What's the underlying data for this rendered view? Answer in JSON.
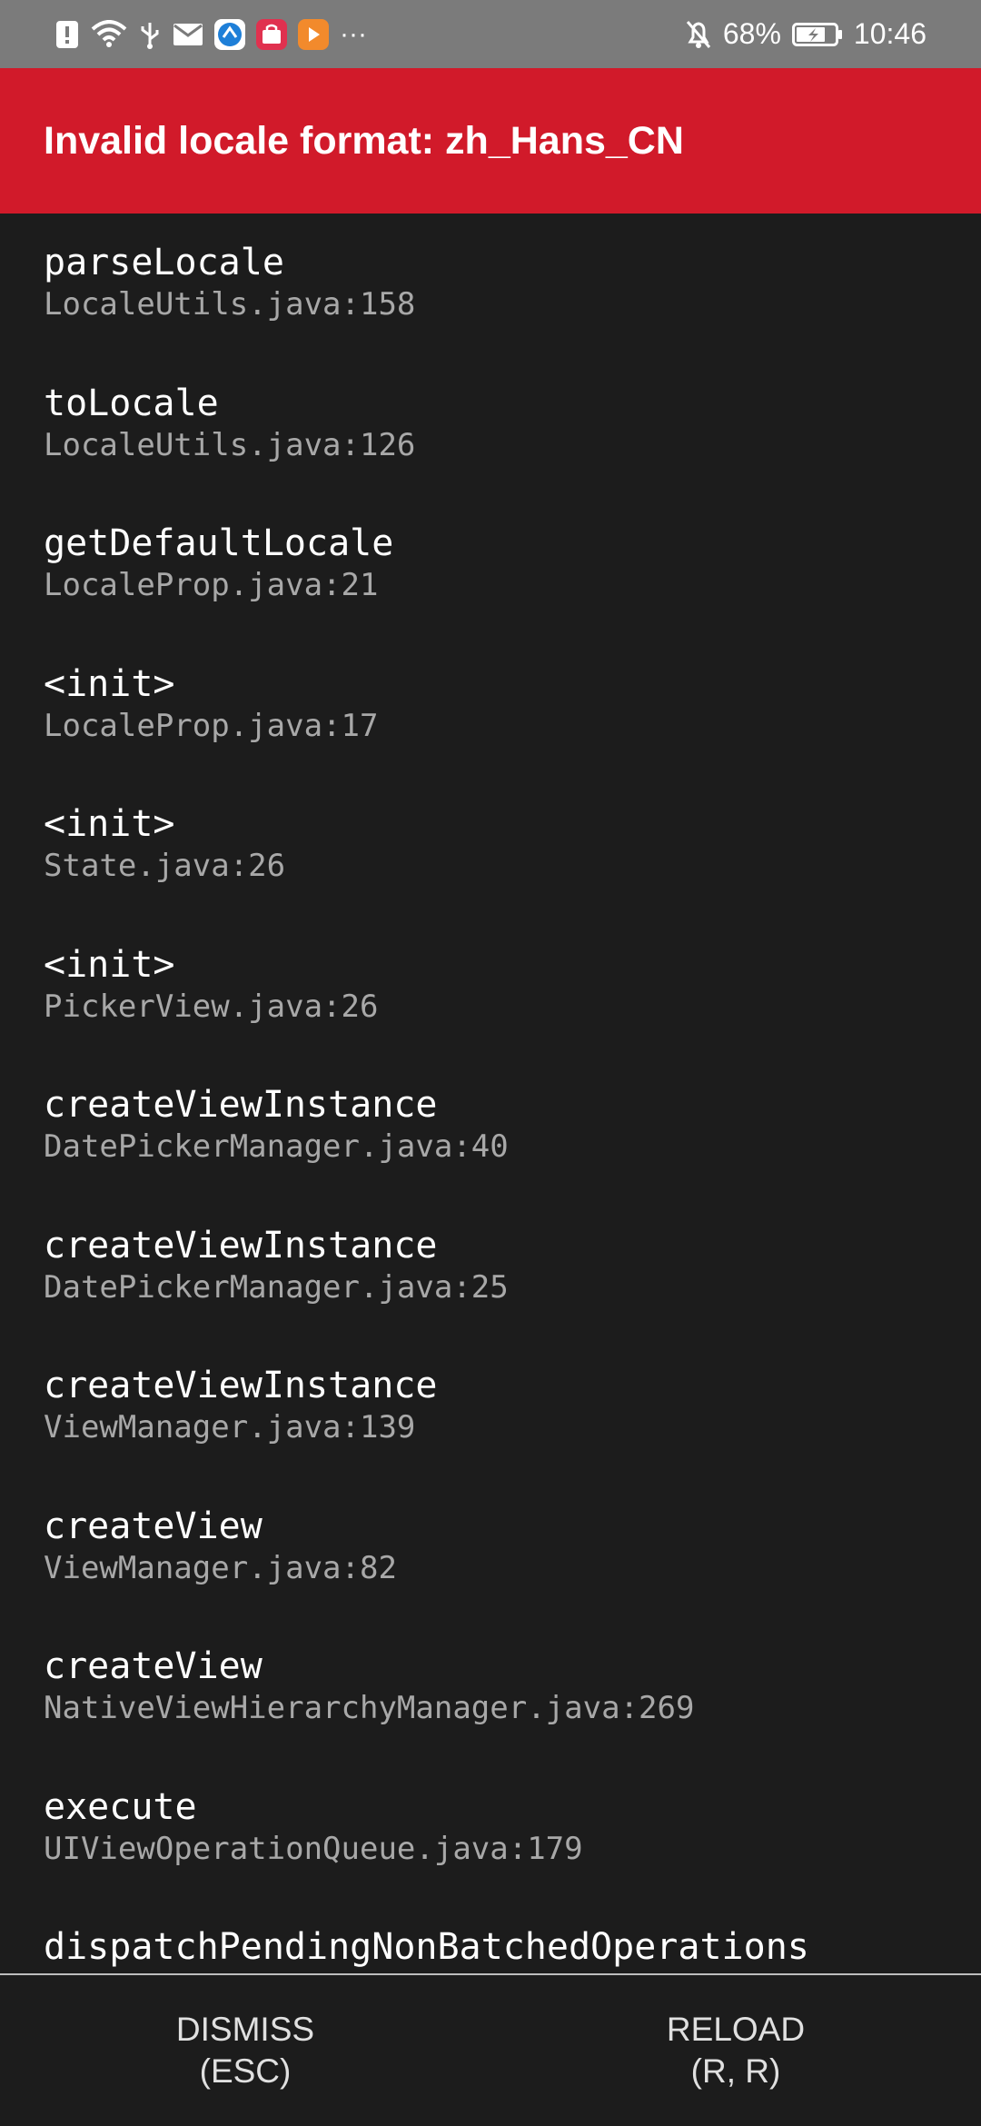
{
  "status_bar": {
    "battery_percent": "68%",
    "time": "10:46",
    "overflow": "···",
    "icons": [
      "alert-icon",
      "wifi-icon",
      "usb-icon",
      "mail-icon",
      "app-icon-blue",
      "app-icon-red",
      "app-icon-orange",
      "mute-icon",
      "battery-icon"
    ],
    "colors": {
      "app_blue": "#1e7fd8",
      "app_red": "#e0314f",
      "app_orange": "#f28a2c"
    }
  },
  "header": {
    "title": "Invalid locale format: zh_Hans_CN",
    "color": "#d11a2a"
  },
  "stack_frames": [
    {
      "method": "parseLocale",
      "file": "LocaleUtils.java:158"
    },
    {
      "method": "toLocale",
      "file": "LocaleUtils.java:126"
    },
    {
      "method": "getDefaultLocale",
      "file": "LocaleProp.java:21"
    },
    {
      "method": "<init>",
      "file": "LocaleProp.java:17"
    },
    {
      "method": "<init>",
      "file": "State.java:26"
    },
    {
      "method": "<init>",
      "file": "PickerView.java:26"
    },
    {
      "method": "createViewInstance",
      "file": "DatePickerManager.java:40"
    },
    {
      "method": "createViewInstance",
      "file": "DatePickerManager.java:25"
    },
    {
      "method": "createViewInstance",
      "file": "ViewManager.java:139"
    },
    {
      "method": "createView",
      "file": "ViewManager.java:82"
    },
    {
      "method": "createView",
      "file": "NativeViewHierarchyManager.java:269"
    },
    {
      "method": "execute",
      "file": "UIViewOperationQueue.java:179"
    },
    {
      "method": "dispatchPendingNonBatchedOperations",
      "file": ""
    }
  ],
  "footer": {
    "dismiss_label": "DISMISS",
    "dismiss_shortcut": "(ESC)",
    "reload_label": "RELOAD",
    "reload_shortcut": "(R, R)"
  }
}
